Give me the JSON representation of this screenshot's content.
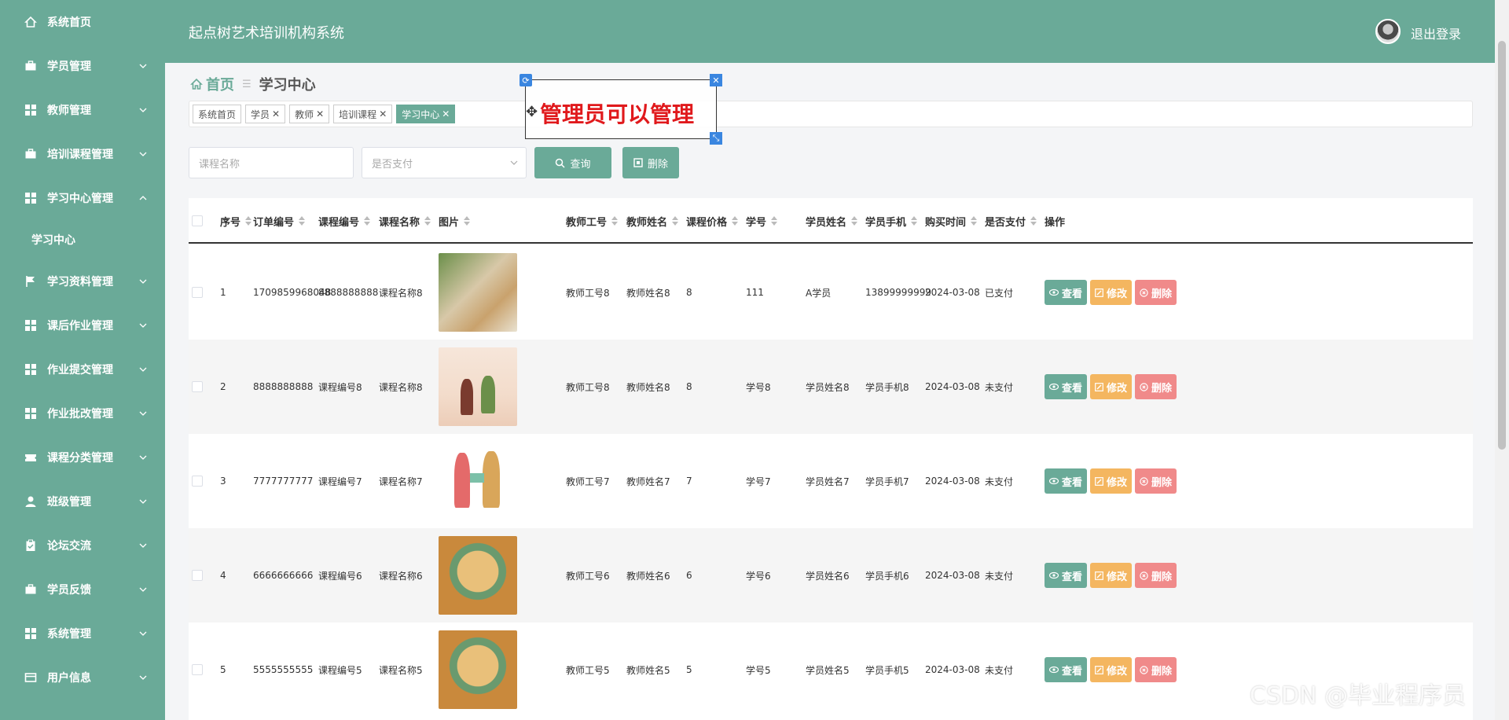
{
  "header": {
    "app_title": "起点树艺术培训机构系统",
    "logout": "退出登录"
  },
  "sidebar": {
    "items": [
      {
        "label": "系统首页",
        "icon": "home-icon",
        "has_arrow": false
      },
      {
        "label": "学员管理",
        "icon": "briefcase-icon",
        "has_arrow": true
      },
      {
        "label": "教师管理",
        "icon": "grid-icon",
        "has_arrow": true
      },
      {
        "label": "培训课程管理",
        "icon": "briefcase-icon",
        "has_arrow": true
      },
      {
        "label": "学习中心管理",
        "icon": "grid-icon",
        "has_arrow": true,
        "open": true
      },
      {
        "label": "学习资料管理",
        "icon": "flag-icon",
        "has_arrow": true
      },
      {
        "label": "课后作业管理",
        "icon": "grid-icon",
        "has_arrow": true
      },
      {
        "label": "作业提交管理",
        "icon": "grid-icon",
        "has_arrow": true
      },
      {
        "label": "作业批改管理",
        "icon": "grid-icon",
        "has_arrow": true
      },
      {
        "label": "课程分类管理",
        "icon": "ticket-icon",
        "has_arrow": true
      },
      {
        "label": "班级管理",
        "icon": "user-icon",
        "has_arrow": true
      },
      {
        "label": "论坛交流",
        "icon": "clipboard-icon",
        "has_arrow": true
      },
      {
        "label": "学员反馈",
        "icon": "briefcase-icon",
        "has_arrow": true
      },
      {
        "label": "系统管理",
        "icon": "grid-icon",
        "has_arrow": true
      },
      {
        "label": "用户信息",
        "icon": "card-icon",
        "has_arrow": true
      }
    ],
    "submenu": {
      "label": "学习中心"
    }
  },
  "breadcrumb": {
    "home": "首页",
    "current": "学习中心"
  },
  "tags": [
    {
      "label": "系统首页",
      "closable": false,
      "active": false
    },
    {
      "label": "学员",
      "closable": true,
      "active": false
    },
    {
      "label": "教师",
      "closable": true,
      "active": false
    },
    {
      "label": "培训课程",
      "closable": true,
      "active": false
    },
    {
      "label": "学习中心",
      "closable": true,
      "active": true
    }
  ],
  "annotation": {
    "text": "管理员可以管理"
  },
  "search": {
    "course_name_placeholder": "课程名称",
    "paid_placeholder": "是否支付",
    "query_label": "查询",
    "delete_label": "删除"
  },
  "table": {
    "headers": [
      "序号",
      "订单编号",
      "课程编号",
      "课程名称",
      "图片",
      "教师工号",
      "教师姓名",
      "课程价格",
      "学号",
      "学员姓名",
      "学员手机",
      "购买时间",
      "是否支付",
      "操作"
    ],
    "ops": {
      "view": "查看",
      "edit": "修改",
      "del": "删除"
    },
    "rows": [
      {
        "idx": "1",
        "order_no": "1709859968048",
        "course_no": "8888888888",
        "course_name": "课程名称8",
        "teacher_no": "教师工号8",
        "teacher_name": "教师姓名8",
        "price": "8",
        "student_no": "111",
        "student_name": "A学员",
        "phone": "13899999999",
        "time": "2024-03-08",
        "paid": "已支付"
      },
      {
        "idx": "2",
        "order_no": "8888888888",
        "course_no": "课程编号8",
        "course_name": "课程名称8",
        "teacher_no": "教师工号8",
        "teacher_name": "教师姓名8",
        "price": "8",
        "student_no": "学号8",
        "student_name": "学员姓名8",
        "phone": "学员手机8",
        "time": "2024-03-08",
        "paid": "未支付"
      },
      {
        "idx": "3",
        "order_no": "7777777777",
        "course_no": "课程编号7",
        "course_name": "课程名称7",
        "teacher_no": "教师工号7",
        "teacher_name": "教师姓名7",
        "price": "7",
        "student_no": "学号7",
        "student_name": "学员姓名7",
        "phone": "学员手机7",
        "time": "2024-03-08",
        "paid": "未支付"
      },
      {
        "idx": "4",
        "order_no": "6666666666",
        "course_no": "课程编号6",
        "course_name": "课程名称6",
        "teacher_no": "教师工号6",
        "teacher_name": "教师姓名6",
        "price": "6",
        "student_no": "学号6",
        "student_name": "学员姓名6",
        "phone": "学员手机6",
        "time": "2024-03-08",
        "paid": "未支付"
      },
      {
        "idx": "5",
        "order_no": "5555555555",
        "course_no": "课程编号5",
        "course_name": "课程名称5",
        "teacher_no": "教师工号5",
        "teacher_name": "教师姓名5",
        "price": "5",
        "student_no": "学号5",
        "student_name": "学员姓名5",
        "phone": "学员手机5",
        "time": "2024-03-08",
        "paid": "未支付"
      }
    ]
  },
  "watermark": "CSDN @毕业程序员",
  "colors": {
    "primary": "#6aaa98",
    "edit": "#f4b660",
    "delete": "#f08a8a",
    "annotation": "#e0191c"
  }
}
